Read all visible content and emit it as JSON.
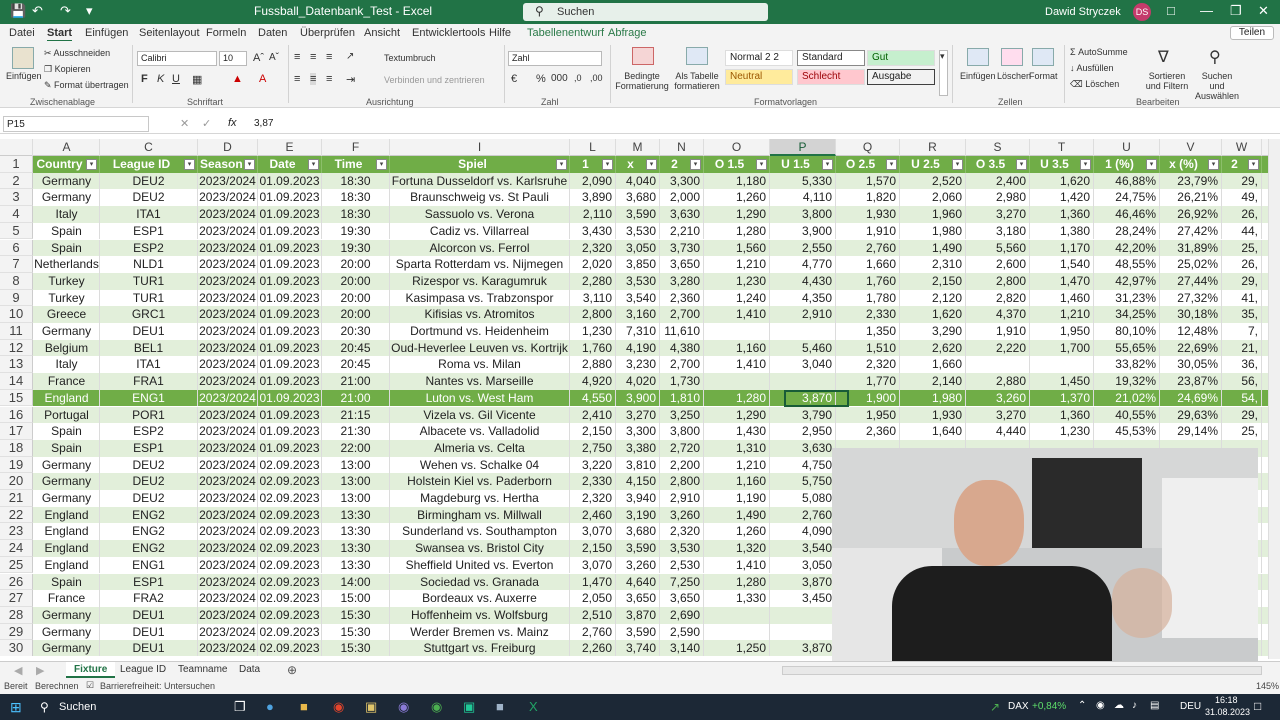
{
  "window": {
    "title": "Fussball_Datenbank_Test - Excel",
    "search_placeholder": "Suchen",
    "user": "Dawid Stryczek",
    "initials": "DS"
  },
  "menu": {
    "items": [
      "Datei",
      "Start",
      "Einfügen",
      "Seitenlayout",
      "Formeln",
      "Daten",
      "Überprüfen",
      "Ansicht",
      "Entwicklertools",
      "Hilfe",
      "Tabellenentwurf",
      "Abfrage"
    ],
    "share": "Teilen"
  },
  "ribbon": {
    "paste": "Einfügen",
    "cut": "Ausschneiden",
    "copy": "Kopieren",
    "format_painter": "Format übertragen",
    "clipboard": "Zwischenablage",
    "font_name": "Calibri",
    "font_size": "10",
    "font": "Schriftart",
    "wrap": "Textumbruch",
    "merge": "Verbinden und zentrieren",
    "alignment": "Ausrichtung",
    "number_format": "Zahl",
    "number": "Zahl",
    "cond_format": "Bedingte Formatierung",
    "as_table": "Als Tabelle formatieren",
    "styles": {
      "normal2": "Normal 2 2",
      "standard": "Standard",
      "good": "Gut",
      "neutral": "Neutral",
      "bad": "Schlecht",
      "output": "Ausgabe"
    },
    "templates": "Formatvorlagen",
    "insert": "Einfügen",
    "delete": "Löschen",
    "format": "Format",
    "cells": "Zellen",
    "autosum": "AutoSumme",
    "fill": "Ausfüllen",
    "clear": "Löschen",
    "sort": "Sortieren und Filtern",
    "find": "Suchen und Auswählen",
    "editing": "Bearbeiten"
  },
  "formula_bar": {
    "name_box": "P15",
    "fx": "fx",
    "value": "3,87"
  },
  "columns": [
    "A",
    "C",
    "D",
    "E",
    "F",
    "I",
    "L",
    "M",
    "N",
    "O",
    "P",
    "Q",
    "R",
    "S",
    "T",
    "U",
    "V",
    "W"
  ],
  "header": [
    "Country",
    "League ID",
    "Season",
    "Date",
    "Time",
    "Spiel",
    "1",
    "x",
    "2",
    "O 1.5",
    "U 1.5",
    "O 2.5",
    "U 2.5",
    "O 3.5",
    "U 3.5",
    "1 (%)",
    "x (%)",
    "2"
  ],
  "rows": [
    [
      "Germany",
      "DEU2",
      "2023/2024",
      "01.09.2023",
      "18:30",
      "Fortuna Dusseldorf vs. Karlsruhe",
      "2,090",
      "4,040",
      "3,300",
      "1,180",
      "5,330",
      "1,570",
      "2,520",
      "2,400",
      "1,620",
      "46,88%",
      "23,79%",
      "29,"
    ],
    [
      "Germany",
      "DEU2",
      "2023/2024",
      "01.09.2023",
      "18:30",
      "Braunschweig vs. St Pauli",
      "3,890",
      "3,680",
      "2,000",
      "1,260",
      "4,110",
      "1,820",
      "2,060",
      "2,980",
      "1,420",
      "24,75%",
      "26,21%",
      "49,"
    ],
    [
      "Italy",
      "ITA1",
      "2023/2024",
      "01.09.2023",
      "18:30",
      "Sassuolo vs. Verona",
      "2,110",
      "3,590",
      "3,630",
      "1,290",
      "3,800",
      "1,930",
      "1,960",
      "3,270",
      "1,360",
      "46,46%",
      "26,92%",
      "26,"
    ],
    [
      "Spain",
      "ESP1",
      "2023/2024",
      "01.09.2023",
      "19:30",
      "Cadiz vs. Villarreal",
      "3,430",
      "3,530",
      "2,210",
      "1,280",
      "3,900",
      "1,910",
      "1,980",
      "3,180",
      "1,380",
      "28,24%",
      "27,42%",
      "44,"
    ],
    [
      "Spain",
      "ESP2",
      "2023/2024",
      "01.09.2023",
      "19:30",
      "Alcorcon vs. Ferrol",
      "2,320",
      "3,050",
      "3,730",
      "1,560",
      "2,550",
      "2,760",
      "1,490",
      "5,560",
      "1,170",
      "42,20%",
      "31,89%",
      "25,"
    ],
    [
      "Netherlands",
      "NLD1",
      "2023/2024",
      "01.09.2023",
      "20:00",
      "Sparta Rotterdam vs. Nijmegen",
      "2,020",
      "3,850",
      "3,650",
      "1,210",
      "4,770",
      "1,660",
      "2,310",
      "2,600",
      "1,540",
      "48,55%",
      "25,02%",
      "26,"
    ],
    [
      "Turkey",
      "TUR1",
      "2023/2024",
      "01.09.2023",
      "20:00",
      "Rizespor vs. Karagumruk",
      "2,280",
      "3,530",
      "3,280",
      "1,230",
      "4,430",
      "1,760",
      "2,150",
      "2,800",
      "1,470",
      "42,97%",
      "27,44%",
      "29,"
    ],
    [
      "Turkey",
      "TUR1",
      "2023/2024",
      "01.09.2023",
      "20:00",
      "Kasimpasa vs. Trabzonspor",
      "3,110",
      "3,540",
      "2,360",
      "1,240",
      "4,350",
      "1,780",
      "2,120",
      "2,820",
      "1,460",
      "31,23%",
      "27,32%",
      "41,"
    ],
    [
      "Greece",
      "GRC1",
      "2023/2024",
      "01.09.2023",
      "20:00",
      "Kifisias vs. Atromitos",
      "2,800",
      "3,160",
      "2,700",
      "1,410",
      "2,910",
      "2,330",
      "1,620",
      "4,370",
      "1,210",
      "34,25%",
      "30,18%",
      "35,"
    ],
    [
      "Germany",
      "DEU1",
      "2023/2024",
      "01.09.2023",
      "20:30",
      "Dortmund vs. Heidenheim",
      "1,230",
      "7,310",
      "11,610",
      "",
      "",
      "1,350",
      "3,290",
      "1,910",
      "1,950",
      "80,10%",
      "12,48%",
      "7,"
    ],
    [
      "Belgium",
      "BEL1",
      "2023/2024",
      "01.09.2023",
      "20:45",
      "Oud-Heverlee Leuven vs. Kortrijk",
      "1,760",
      "4,190",
      "4,380",
      "1,160",
      "5,460",
      "1,510",
      "2,620",
      "2,220",
      "1,700",
      "55,65%",
      "22,69%",
      "21,"
    ],
    [
      "Italy",
      "ITA1",
      "2023/2024",
      "01.09.2023",
      "20:45",
      "Roma vs. Milan",
      "2,880",
      "3,230",
      "2,700",
      "1,410",
      "3,040",
      "2,320",
      "1,660",
      "",
      "",
      "33,82%",
      "30,05%",
      "36,"
    ],
    [
      "France",
      "FRA1",
      "2023/2024",
      "01.09.2023",
      "21:00",
      "Nantes vs. Marseille",
      "4,920",
      "4,020",
      "1,730",
      "",
      "",
      "1,770",
      "2,140",
      "2,880",
      "1,450",
      "19,32%",
      "23,87%",
      "56,"
    ],
    [
      "England",
      "ENG1",
      "2023/2024",
      "01.09.2023",
      "21:00",
      "Luton vs. West Ham",
      "4,550",
      "3,900",
      "1,810",
      "1,280",
      "3,870",
      "1,900",
      "1,980",
      "3,260",
      "1,370",
      "21,02%",
      "24,69%",
      "54,"
    ],
    [
      "Portugal",
      "POR1",
      "2023/2024",
      "01.09.2023",
      "21:15",
      "Vizela vs. Gil Vicente",
      "2,410",
      "3,270",
      "3,250",
      "1,290",
      "3,790",
      "1,950",
      "1,930",
      "3,270",
      "1,360",
      "40,55%",
      "29,63%",
      "29,"
    ],
    [
      "Spain",
      "ESP2",
      "2023/2024",
      "01.09.2023",
      "21:30",
      "Albacete vs. Valladolid",
      "2,150",
      "3,300",
      "3,800",
      "1,430",
      "2,950",
      "2,360",
      "1,640",
      "4,440",
      "1,230",
      "45,53%",
      "29,14%",
      "25,"
    ],
    [
      "Spain",
      "ESP1",
      "2023/2024",
      "01.09.2023",
      "22:00",
      "Almeria vs. Celta",
      "2,750",
      "3,380",
      "2,720",
      "1,310",
      "3,630",
      "",
      "",
      "",
      "",
      "",
      "",
      ""
    ],
    [
      "Germany",
      "DEU2",
      "2023/2024",
      "02.09.2023",
      "13:00",
      "Wehen vs. Schalke 04",
      "3,220",
      "3,810",
      "2,200",
      "1,210",
      "4,750",
      "",
      "",
      "",
      "",
      "",
      "",
      ""
    ],
    [
      "Germany",
      "DEU2",
      "2023/2024",
      "02.09.2023",
      "13:00",
      "Holstein Kiel vs. Paderborn",
      "2,330",
      "4,150",
      "2,800",
      "1,160",
      "5,750",
      "",
      "",
      "",
      "",
      "",
      "",
      ""
    ],
    [
      "Germany",
      "DEU2",
      "2023/2024",
      "02.09.2023",
      "13:00",
      "Magdeburg vs. Hertha",
      "2,320",
      "3,940",
      "2,910",
      "1,190",
      "5,080",
      "",
      "",
      "",
      "",
      "",
      "",
      ""
    ],
    [
      "England",
      "ENG2",
      "2023/2024",
      "02.09.2023",
      "13:30",
      "Birmingham vs. Millwall",
      "2,460",
      "3,190",
      "3,260",
      "1,490",
      "2,760",
      "",
      "",
      "",
      "",
      "",
      "",
      ""
    ],
    [
      "England",
      "ENG2",
      "2023/2024",
      "02.09.2023",
      "13:30",
      "Sunderland vs. Southampton",
      "3,070",
      "3,680",
      "2,320",
      "1,260",
      "4,090",
      "",
      "",
      "",
      "",
      "",
      "",
      ""
    ],
    [
      "England",
      "ENG2",
      "2023/2024",
      "02.09.2023",
      "13:30",
      "Swansea vs. Bristol City",
      "2,150",
      "3,590",
      "3,530",
      "1,320",
      "3,540",
      "",
      "",
      "",
      "",
      "",
      "",
      ""
    ],
    [
      "England",
      "ENG1",
      "2023/2024",
      "02.09.2023",
      "13:30",
      "Sheffield United vs. Everton",
      "3,070",
      "3,260",
      "2,530",
      "1,410",
      "3,050",
      "",
      "",
      "",
      "",
      "",
      "",
      ""
    ],
    [
      "Spain",
      "ESP1",
      "2023/2024",
      "02.09.2023",
      "14:00",
      "Sociedad vs. Granada",
      "1,470",
      "4,640",
      "7,250",
      "1,280",
      "3,870",
      "",
      "",
      "",
      "",
      "",
      "",
      ""
    ],
    [
      "France",
      "FRA2",
      "2023/2024",
      "02.09.2023",
      "15:00",
      "Bordeaux vs. Auxerre",
      "2,050",
      "3,650",
      "3,650",
      "1,330",
      "3,450",
      "",
      "",
      "",
      "",
      "",
      "",
      ""
    ],
    [
      "Germany",
      "DEU1",
      "2023/2024",
      "02.09.2023",
      "15:30",
      "Hoffenheim vs. Wolfsburg",
      "2,510",
      "3,870",
      "2,690",
      "",
      "",
      "",
      "",
      "",
      "",
      "",
      "",
      ""
    ],
    [
      "Germany",
      "DEU1",
      "2023/2024",
      "02.09.2023",
      "15:30",
      "Werder Bremen vs. Mainz",
      "2,760",
      "3,590",
      "2,590",
      "",
      "",
      "",
      "",
      "",
      "",
      "",
      "",
      ""
    ],
    [
      "Germany",
      "DEU1",
      "2023/2024",
      "02.09.2023",
      "15:30",
      "Stuttgart vs. Freiburg",
      "2,260",
      "3,740",
      "3,140",
      "1,250",
      "3,870",
      "",
      "",
      "",
      "",
      "",
      "",
      ""
    ]
  ],
  "sheets": [
    "Fixture",
    "League ID",
    "Teamname",
    "Data"
  ],
  "status": {
    "ready": "Bereit",
    "calc": "Berechnen",
    "accessibility": "Barrierefreiheit: Untersuchen",
    "zoom": "145%"
  },
  "taskbar": {
    "search": "Suchen",
    "ticker": "DAX",
    "ticker_change": "+0,84%",
    "lang": "DEU",
    "time": "16:18",
    "date": "31.08.2023"
  },
  "colors": {
    "excel_green": "#217346",
    "header_green": "#70ad47",
    "band": "#e2efda"
  }
}
